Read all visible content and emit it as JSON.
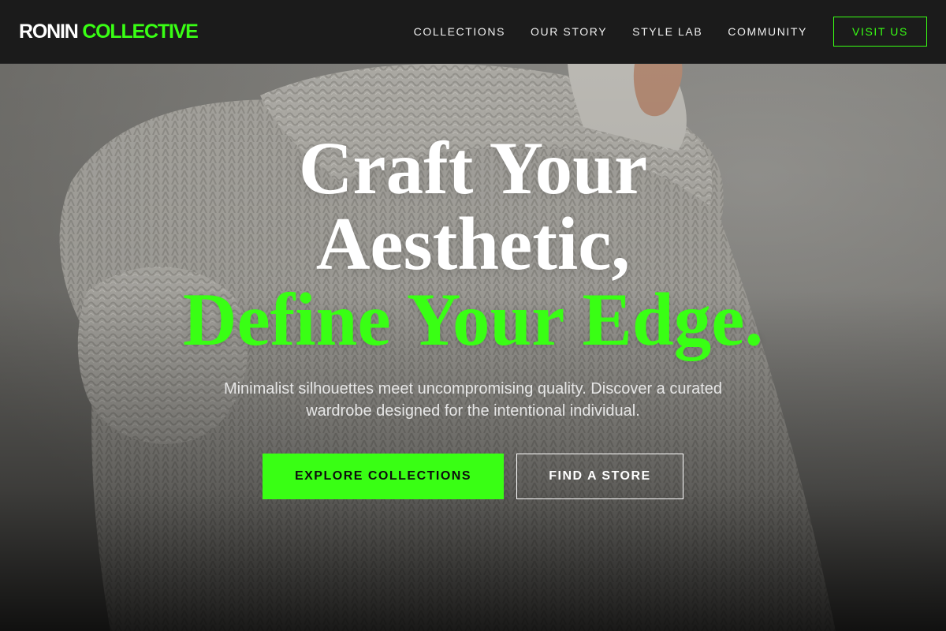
{
  "brand": {
    "name_part1": "RONIN",
    "name_part2": "COLLECTIVE",
    "accent_color": "#39ff14"
  },
  "nav": {
    "links": [
      {
        "label": "COLLECTIONS"
      },
      {
        "label": "OUR STORY"
      },
      {
        "label": "STYLE LAB"
      },
      {
        "label": "COMMUNITY"
      }
    ],
    "cta_label": "VISIT US"
  },
  "hero": {
    "headline_line1": "Craft Your",
    "headline_line2": "Aesthetic,",
    "headline_accent": "Define Your Edge.",
    "subtitle": "Minimalist silhouettes meet uncompromising quality. Discover a curated wardrobe designed for the intentional individual.",
    "primary_cta": "EXPLORE COLLECTIONS",
    "secondary_cta": "FIND A STORE",
    "background_image": "knit-sweater-photo"
  }
}
